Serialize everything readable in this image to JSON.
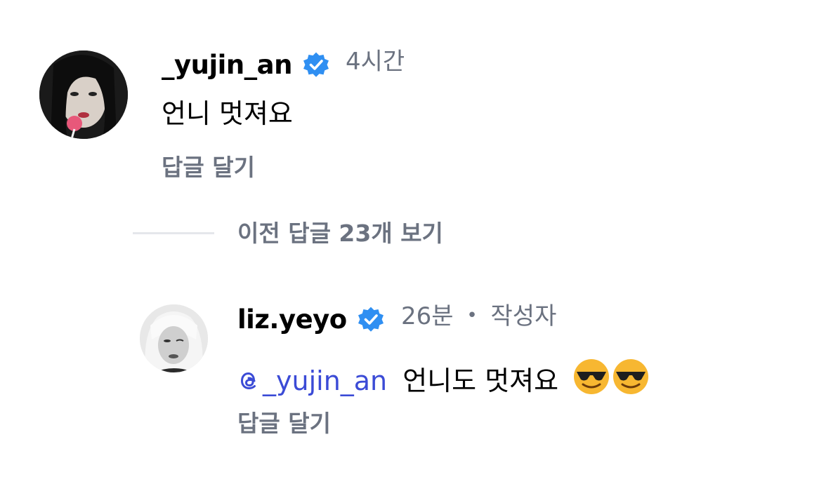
{
  "comments": [
    {
      "username": "_yujin_an",
      "time": "4시간",
      "text": "언니 멋져요",
      "reply_label": "답글 달기"
    }
  ],
  "view_previous_replies": "이전 답글 23개 보기",
  "reply": {
    "username": "liz.yeyo",
    "time": "26분",
    "separator": "•",
    "author_badge": "작성자",
    "mention": "_yujin_an",
    "text": "언니도 멋져요",
    "emojis": [
      "smiling-face-with-sunglasses",
      "smiling-face-with-sunglasses"
    ],
    "reply_label": "답글 달기"
  },
  "colors": {
    "verified": "#2f8ff2",
    "mention": "#3b4bd6",
    "muted": "#6b7280"
  }
}
